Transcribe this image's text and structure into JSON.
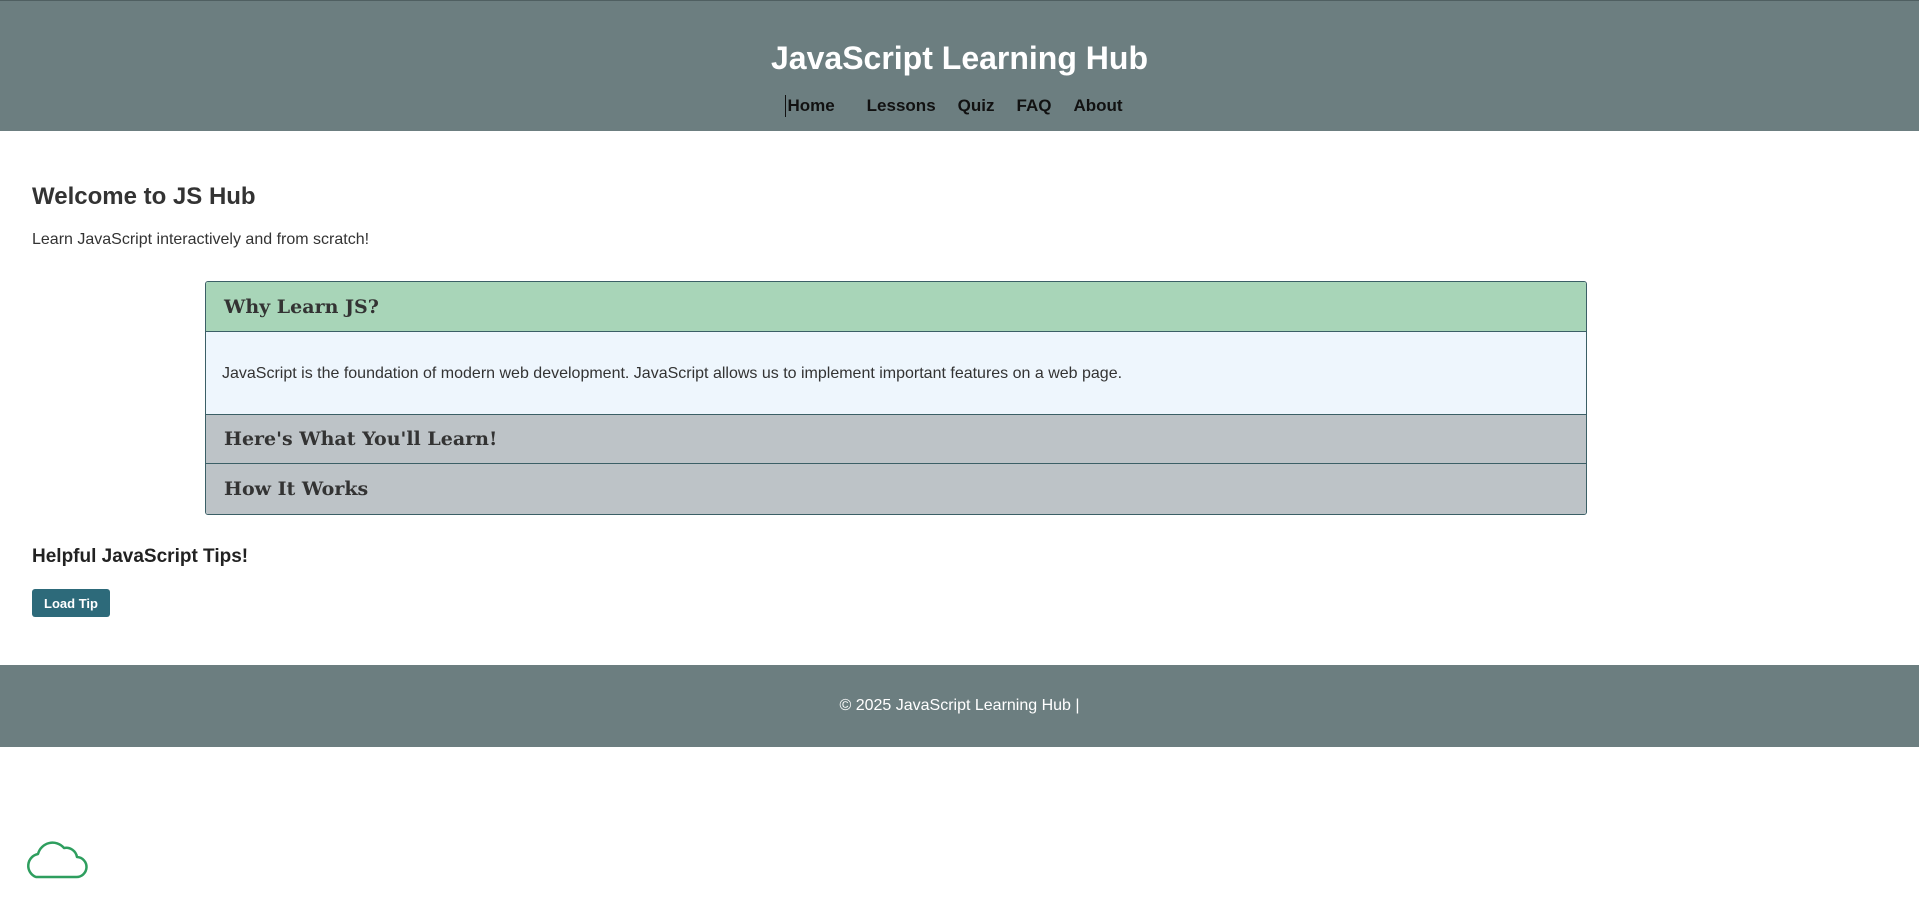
{
  "header": {
    "title": "JavaScript Learning Hub",
    "nav": [
      "Home",
      "Lessons",
      "Quiz",
      "FAQ",
      "About"
    ]
  },
  "main": {
    "welcome_title": "Welcome to JS Hub",
    "welcome_text": "Learn JavaScript interactively and from scratch!",
    "accordion": [
      {
        "title": "Why Learn JS?",
        "expanded": true,
        "body": "JavaScript is the foundation of modern web development. JavaScript allows us to implement important features on a web page."
      },
      {
        "title": "Here's What You'll Learn!",
        "expanded": false
      },
      {
        "title": "How It Works",
        "expanded": false
      }
    ],
    "tips_title": "Helpful JavaScript Tips!",
    "load_tip_label": "Load Tip"
  },
  "footer": {
    "text": "© 2025 JavaScript Learning Hub |"
  },
  "icons": {
    "cloud": "cloud-icon"
  },
  "colors": {
    "header_bg": "#6c7e80",
    "accordion_active": "#a8d5b8",
    "accordion_inactive": "#bdc3c7",
    "accordion_body": "#eef6fd",
    "button_bg": "#2d6a7a",
    "cloud_stroke": "#2e9e5e"
  }
}
